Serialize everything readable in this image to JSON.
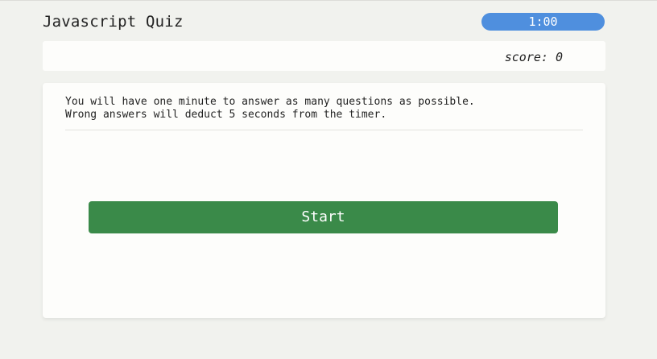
{
  "header": {
    "title": "Javascript Quiz",
    "timer": "1:00"
  },
  "scorebar": {
    "score_text": "score: 0"
  },
  "card": {
    "instructions": [
      "You will have one minute to answer as many questions as possible.",
      "Wrong answers will deduct 5 seconds from the timer."
    ],
    "start_label": "Start"
  },
  "colors": {
    "background": "#f1f2ee",
    "timer": "#4f8fde",
    "start_button": "#3a8a49"
  }
}
